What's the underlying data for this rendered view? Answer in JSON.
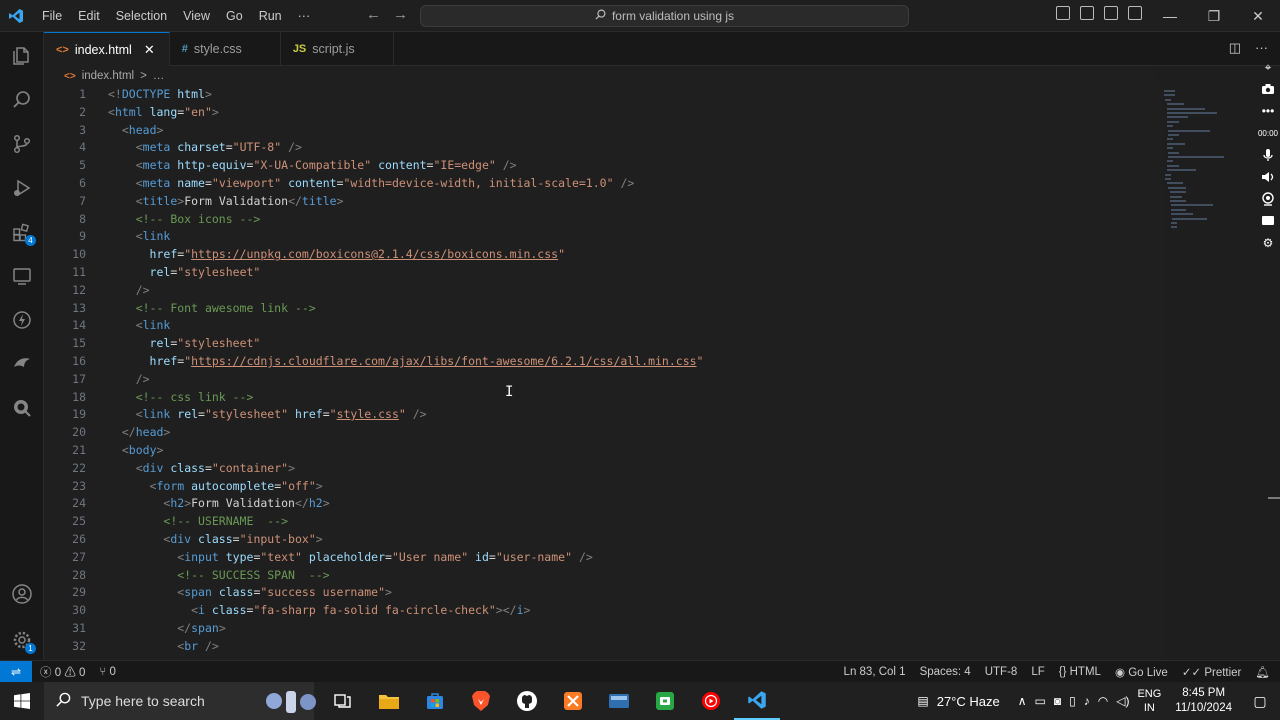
{
  "menubar": {
    "items": [
      "File",
      "Edit",
      "Selection",
      "View",
      "Go",
      "Run",
      "···"
    ]
  },
  "command_center": {
    "text": "form validation using js"
  },
  "tabs": [
    {
      "label": "index.html",
      "icon": "html-file-icon",
      "active": true
    },
    {
      "label": "style.css",
      "icon": "css-file-icon",
      "active": false
    },
    {
      "label": "script.js",
      "icon": "js-file-icon",
      "active": false
    }
  ],
  "breadcrumb": {
    "file": "index.html",
    "separator": ">",
    "more": "…"
  },
  "line_numbers": [
    "1",
    "2",
    "3",
    "4",
    "5",
    "6",
    "7",
    "8",
    "9",
    "10",
    "11",
    "12",
    "13",
    "14",
    "15",
    "16",
    "17",
    "18",
    "19",
    "20",
    "21",
    "22",
    "23",
    "24",
    "25",
    "26",
    "27",
    "28",
    "29",
    "30",
    "31",
    "32"
  ],
  "code_lines": [
    [
      [
        "p",
        "<!"
      ],
      [
        "t",
        "DOCTYPE"
      ],
      [
        "a",
        " html"
      ],
      [
        "p",
        ">"
      ]
    ],
    [
      [
        "p",
        "<"
      ],
      [
        "t",
        "html"
      ],
      [
        "a",
        " lang"
      ],
      [
        "x",
        "="
      ],
      [
        "s",
        "\"en\""
      ],
      [
        "p",
        ">"
      ]
    ],
    [
      [
        "x",
        "  "
      ],
      [
        "p",
        "<"
      ],
      [
        "t",
        "head"
      ],
      [
        "p",
        ">"
      ]
    ],
    [
      [
        "x",
        "    "
      ],
      [
        "p",
        "<"
      ],
      [
        "t",
        "meta"
      ],
      [
        "a",
        " charset"
      ],
      [
        "x",
        "="
      ],
      [
        "s",
        "\"UTF-8\""
      ],
      [
        "p",
        " />"
      ]
    ],
    [
      [
        "x",
        "    "
      ],
      [
        "p",
        "<"
      ],
      [
        "t",
        "meta"
      ],
      [
        "a",
        " http-equiv"
      ],
      [
        "x",
        "="
      ],
      [
        "s",
        "\"X-UA-Compatible\""
      ],
      [
        "a",
        " content"
      ],
      [
        "x",
        "="
      ],
      [
        "s",
        "\"IE=edge\""
      ],
      [
        "p",
        " />"
      ]
    ],
    [
      [
        "x",
        "    "
      ],
      [
        "p",
        "<"
      ],
      [
        "t",
        "meta"
      ],
      [
        "a",
        " name"
      ],
      [
        "x",
        "="
      ],
      [
        "s",
        "\"viewport\""
      ],
      [
        "a",
        " content"
      ],
      [
        "x",
        "="
      ],
      [
        "s",
        "\"width=device-width, initial-scale=1.0\""
      ],
      [
        "p",
        " />"
      ]
    ],
    [
      [
        "x",
        "    "
      ],
      [
        "p",
        "<"
      ],
      [
        "t",
        "title"
      ],
      [
        "p",
        ">"
      ],
      [
        "x",
        "Form Validation"
      ],
      [
        "p",
        "</"
      ],
      [
        "t",
        "title"
      ],
      [
        "p",
        ">"
      ]
    ],
    [
      [
        "x",
        "    "
      ],
      [
        "c",
        "<!-- Box icons -->"
      ]
    ],
    [
      [
        "x",
        "    "
      ],
      [
        "p",
        "<"
      ],
      [
        "t",
        "link"
      ]
    ],
    [
      [
        "x",
        "      "
      ],
      [
        "a",
        "href"
      ],
      [
        "x",
        "="
      ],
      [
        "s",
        "\""
      ],
      [
        "l",
        "https://unpkg.com/boxicons@2.1.4/css/boxicons.min.css"
      ],
      [
        "s",
        "\""
      ]
    ],
    [
      [
        "x",
        "      "
      ],
      [
        "a",
        "rel"
      ],
      [
        "x",
        "="
      ],
      [
        "s",
        "\"stylesheet\""
      ]
    ],
    [
      [
        "x",
        "    "
      ],
      [
        "p",
        "/>"
      ]
    ],
    [
      [
        "x",
        "    "
      ],
      [
        "c",
        "<!-- Font awesome link -->"
      ]
    ],
    [
      [
        "x",
        "    "
      ],
      [
        "p",
        "<"
      ],
      [
        "t",
        "link"
      ]
    ],
    [
      [
        "x",
        "      "
      ],
      [
        "a",
        "rel"
      ],
      [
        "x",
        "="
      ],
      [
        "s",
        "\"stylesheet\""
      ]
    ],
    [
      [
        "x",
        "      "
      ],
      [
        "a",
        "href"
      ],
      [
        "x",
        "="
      ],
      [
        "s",
        "\""
      ],
      [
        "l",
        "https://cdnjs.cloudflare.com/ajax/libs/font-awesome/6.2.1/css/all.min.css"
      ],
      [
        "s",
        "\""
      ]
    ],
    [
      [
        "x",
        "    "
      ],
      [
        "p",
        "/>"
      ]
    ],
    [
      [
        "x",
        "    "
      ],
      [
        "c",
        "<!-- css link -->"
      ]
    ],
    [
      [
        "x",
        "    "
      ],
      [
        "p",
        "<"
      ],
      [
        "t",
        "link"
      ],
      [
        "a",
        " rel"
      ],
      [
        "x",
        "="
      ],
      [
        "s",
        "\"stylesheet\""
      ],
      [
        "a",
        " href"
      ],
      [
        "x",
        "="
      ],
      [
        "s",
        "\""
      ],
      [
        "l",
        "style.css"
      ],
      [
        "s",
        "\""
      ],
      [
        "p",
        " />"
      ]
    ],
    [
      [
        "x",
        "  "
      ],
      [
        "p",
        "</"
      ],
      [
        "t",
        "head"
      ],
      [
        "p",
        ">"
      ]
    ],
    [
      [
        "x",
        "  "
      ],
      [
        "p",
        "<"
      ],
      [
        "t",
        "body"
      ],
      [
        "p",
        ">"
      ]
    ],
    [
      [
        "x",
        "    "
      ],
      [
        "p",
        "<"
      ],
      [
        "t",
        "div"
      ],
      [
        "a",
        " class"
      ],
      [
        "x",
        "="
      ],
      [
        "s",
        "\"container\""
      ],
      [
        "p",
        ">"
      ]
    ],
    [
      [
        "x",
        "      "
      ],
      [
        "p",
        "<"
      ],
      [
        "t",
        "form"
      ],
      [
        "a",
        " autocomplete"
      ],
      [
        "x",
        "="
      ],
      [
        "s",
        "\"off\""
      ],
      [
        "p",
        ">"
      ]
    ],
    [
      [
        "x",
        "        "
      ],
      [
        "p",
        "<"
      ],
      [
        "t",
        "h2"
      ],
      [
        "p",
        ">"
      ],
      [
        "x",
        "Form Validation"
      ],
      [
        "p",
        "</"
      ],
      [
        "t",
        "h2"
      ],
      [
        "p",
        ">"
      ]
    ],
    [
      [
        "x",
        "        "
      ],
      [
        "c",
        "<!-- USERNAME  -->"
      ]
    ],
    [
      [
        "x",
        "        "
      ],
      [
        "p",
        "<"
      ],
      [
        "t",
        "div"
      ],
      [
        "a",
        " class"
      ],
      [
        "x",
        "="
      ],
      [
        "s",
        "\"input-box\""
      ],
      [
        "p",
        ">"
      ]
    ],
    [
      [
        "x",
        "          "
      ],
      [
        "p",
        "<"
      ],
      [
        "t",
        "input"
      ],
      [
        "a",
        " type"
      ],
      [
        "x",
        "="
      ],
      [
        "s",
        "\"text\""
      ],
      [
        "a",
        " placeholder"
      ],
      [
        "x",
        "="
      ],
      [
        "s",
        "\"User name\""
      ],
      [
        "a",
        " id"
      ],
      [
        "x",
        "="
      ],
      [
        "s",
        "\"user-name\""
      ],
      [
        "p",
        " />"
      ]
    ],
    [
      [
        "x",
        "          "
      ],
      [
        "c",
        "<!-- SUCCESS SPAN  -->"
      ]
    ],
    [
      [
        "x",
        "          "
      ],
      [
        "p",
        "<"
      ],
      [
        "t",
        "span"
      ],
      [
        "a",
        " class"
      ],
      [
        "x",
        "="
      ],
      [
        "s",
        "\"success username\""
      ],
      [
        "p",
        ">"
      ]
    ],
    [
      [
        "x",
        "            "
      ],
      [
        "p",
        "<"
      ],
      [
        "t",
        "i"
      ],
      [
        "a",
        " class"
      ],
      [
        "x",
        "="
      ],
      [
        "s",
        "\"fa-sharp fa-solid fa-circle-check\""
      ],
      [
        "p",
        "></"
      ],
      [
        "t",
        "i"
      ],
      [
        "p",
        ">"
      ]
    ],
    [
      [
        "x",
        "          "
      ],
      [
        "p",
        "</"
      ],
      [
        "t",
        "span"
      ],
      [
        "p",
        ">"
      ]
    ],
    [
      [
        "x",
        "          "
      ],
      [
        "p",
        "<"
      ],
      [
        "t",
        "br"
      ],
      [
        "p",
        " />"
      ]
    ]
  ],
  "statusbar": {
    "errors": "0",
    "warnings": "0",
    "ports": "0",
    "cursor_position": "Ln 83, Col 1",
    "indentation": "Spaces: 4",
    "encoding": "UTF-8",
    "eol": "LF",
    "language": "HTML",
    "go_live": "Go Live",
    "prettier": "Prettier"
  },
  "taskbar": {
    "search_placeholder": "Type here to search",
    "weather": "27°C  Haze",
    "language_top": "ENG",
    "language_bottom": "IN",
    "time": "8:45 PM",
    "date": "11/10/2024"
  },
  "colors": {
    "accent": "#0078d4",
    "editor_bg": "#1f1f1f",
    "tag": "#569cd6",
    "attribute": "#9cdcfe",
    "string": "#ce9178",
    "comment": "#6a9955"
  }
}
